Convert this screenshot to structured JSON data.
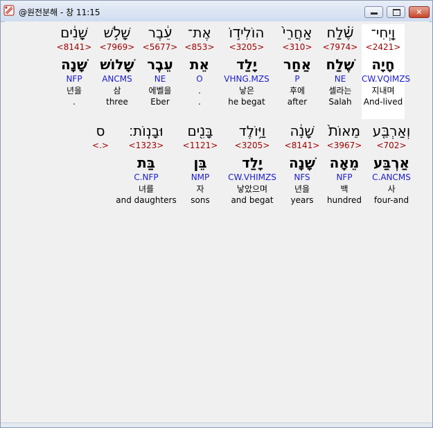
{
  "window": {
    "title": "@원전분해 - 창 11:15",
    "app_icon": "scroll-icon",
    "buttons": {
      "minimize": "minimize-icon",
      "maximize": "maximize-icon",
      "close": "✕"
    }
  },
  "row1": [
    {
      "heb": "וַֽיְחִי־",
      "strong": "<2421>",
      "lemma": "חָיָה",
      "parse": "CW.VQIMZS",
      "kor": "지내며",
      "eng": "And-lived",
      "selected": true
    },
    {
      "heb": "שֶׁ֗לַח",
      "strong": "<7974>",
      "lemma": "שֶׁלַח",
      "parse": "NE",
      "kor": "셀라는",
      "eng": "Salah"
    },
    {
      "heb": "אַחֲרֵי֙",
      "strong": "<310>",
      "lemma": "אַחַר",
      "parse": "P",
      "kor": "후에",
      "eng": "after"
    },
    {
      "heb": "הוֹלִיד֣וֹ",
      "strong": "<3205>",
      "lemma": "יָלַד",
      "parse": "VHNG.MZS",
      "kor": "낳은",
      "eng": "he begat"
    },
    {
      "heb": "אֶת־",
      "strong": "<853>",
      "lemma": "אֵת",
      "parse": "O",
      "kor": ".",
      "eng": "."
    },
    {
      "heb": "עֵ֔בֶר",
      "strong": "<5677>",
      "lemma": "עֵבֶר",
      "parse": "NE",
      "kor": "에벨을",
      "eng": "Eber"
    },
    {
      "heb": "שָׁל֣שׁ",
      "strong": "<7969>",
      "lemma": "שָׁלוֹשׁ",
      "parse": "ANCMS",
      "kor": "삼",
      "eng": "three"
    },
    {
      "heb": "שָׁנִ֔ים",
      "strong": "<8141>",
      "lemma": "שָׁנָה",
      "parse": "NFP",
      "kor": "년을",
      "eng": "."
    }
  ],
  "row2": [
    {
      "heb": "וְאַרְבַּ֤ע",
      "strong": "<702>",
      "lemma": "אַרְבַּע",
      "parse": "C.ANCMS",
      "kor": "사",
      "eng": "four-and"
    },
    {
      "heb": "מֵאוֹת֙",
      "strong": "<3967>",
      "lemma": "מֵאָה",
      "parse": "NFP",
      "kor": "백",
      "eng": "hundred"
    },
    {
      "heb": "שָׁנָ֔ה",
      "strong": "<8141>",
      "lemma": "שָׁנָה",
      "parse": "NFS",
      "kor": "년을",
      "eng": "years"
    },
    {
      "heb": "וַיּ֥וֹלֶד",
      "strong": "<3205>",
      "lemma": "יָלַד",
      "parse": "CW.VHIMZS",
      "kor": "낳았으며",
      "eng": "and begat"
    },
    {
      "heb": "בָּנִ֖ים",
      "strong": "<1121>",
      "lemma": "בֵּן",
      "parse": "NMP",
      "kor": "자",
      "eng": "sons"
    },
    {
      "heb": "וּבָנֽוֹת׃",
      "strong": "<1323>",
      "lemma": "בַּת",
      "parse": "C.NFP",
      "kor": "녀를",
      "eng": "and daughters"
    },
    {
      "heb": "ס",
      "strong": "<.>",
      "lemma": "",
      "parse": "",
      "kor": "",
      "eng": ""
    }
  ]
}
